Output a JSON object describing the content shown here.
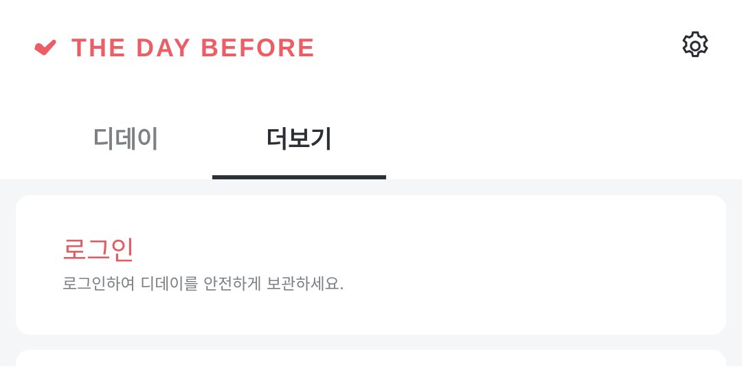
{
  "header": {
    "brand_text": "THE DAY BEFORE",
    "brand_icon": "heart-check-icon",
    "settings_icon": "gear-icon"
  },
  "tabs": [
    {
      "label": "디데이",
      "selected": false
    },
    {
      "label": "더보기",
      "selected": true
    }
  ],
  "login_card": {
    "title": "로그인",
    "description": "로그인하여 디데이를 안전하게 보관하세요."
  },
  "colors": {
    "brand": "#ec5e66",
    "login_title": "#e25c62",
    "tab_indicator": "#2d3036",
    "background": "#f5f6f8"
  }
}
